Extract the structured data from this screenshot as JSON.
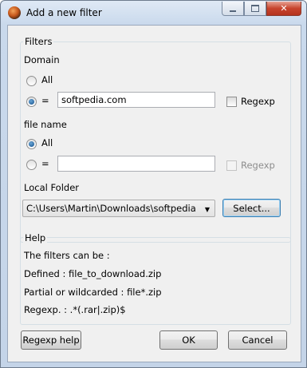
{
  "window": {
    "title": "Add a new filter"
  },
  "filters": {
    "legend": "Filters",
    "domain": {
      "label": "Domain",
      "all_label": "All",
      "equals_label": "=",
      "value": "softpedia.com",
      "regexp_label": "Regexp",
      "selected": "equals"
    },
    "file_name": {
      "label": "file name",
      "all_label": "All",
      "equals_label": "=",
      "value": "",
      "regexp_label": "Regexp",
      "selected": "all"
    },
    "local_folder": {
      "label": "Local Folder",
      "value": "C:\\Users\\Martin\\Downloads\\softpedia",
      "select_label": "Select..."
    }
  },
  "help": {
    "legend": "Help",
    "lines": [
      "The filters can be :",
      "Defined : file_to_download.zip",
      "Partial or wildcarded : file*.zip",
      "Regexp. : .*(.rar|.zip)$"
    ]
  },
  "buttons": {
    "regexp_help": "Regexp help",
    "ok": "OK",
    "cancel": "Cancel"
  },
  "icons": {
    "app": "app-icon",
    "minimize": "minimize-icon",
    "maximize": "maximize-icon",
    "close": "close-icon",
    "dropdown": "chevron-down-icon"
  }
}
